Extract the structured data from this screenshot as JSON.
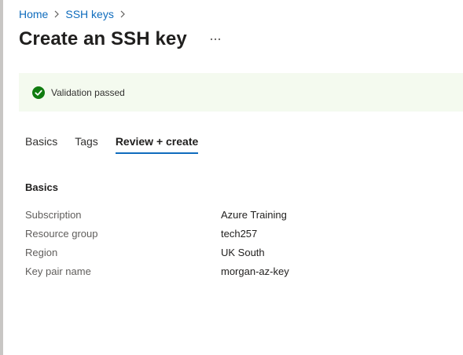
{
  "breadcrumb": {
    "items": [
      {
        "label": "Home"
      },
      {
        "label": "SSH keys"
      }
    ]
  },
  "page": {
    "title": "Create an SSH key",
    "more_icon": "ellipsis-icon"
  },
  "validation": {
    "message": "Validation passed",
    "icon": "check-circle-icon",
    "color": "#107c10"
  },
  "tabs": [
    {
      "label": "Basics",
      "active": false
    },
    {
      "label": "Tags",
      "active": false
    },
    {
      "label": "Review + create",
      "active": true
    }
  ],
  "review": {
    "section_title": "Basics",
    "rows": [
      {
        "label": "Subscription",
        "value": "Azure Training"
      },
      {
        "label": "Resource group",
        "value": "tech257"
      },
      {
        "label": "Region",
        "value": "UK South"
      },
      {
        "label": "Key pair name",
        "value": "morgan-az-key"
      }
    ]
  },
  "colors": {
    "accent": "#0f6cbd",
    "banner_bg": "#f4faef"
  }
}
